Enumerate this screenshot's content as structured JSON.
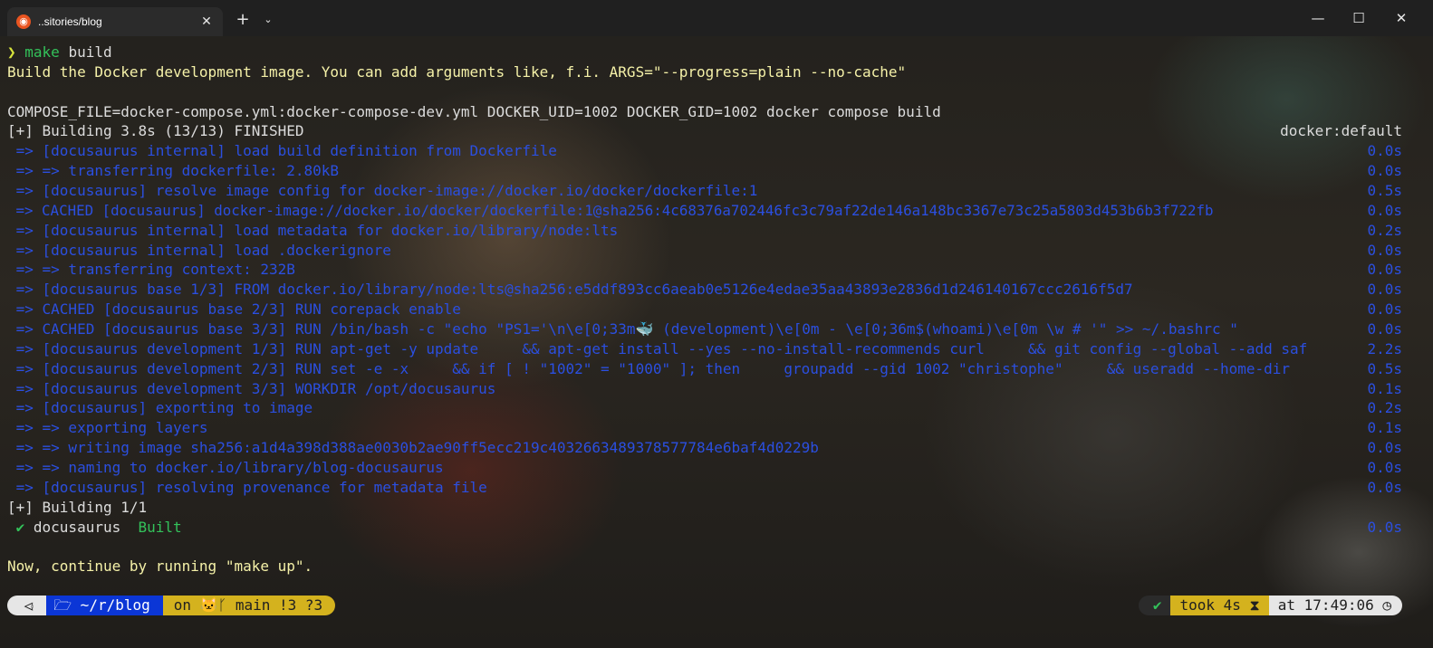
{
  "tab": {
    "title": "..sitories/blog",
    "icon": "ubuntu-icon",
    "close": "✕"
  },
  "titlebar": {
    "new_tab": "+",
    "menu": "⌄",
    "minimize": "—",
    "maximize": "☐",
    "close": "✕"
  },
  "terminal": {
    "prompt_symbol": "❯",
    "command_make": "make",
    "command_arg": " build",
    "build_info": "Build the Docker development image. You can add arguments like, f.i. ARGS=\"--progress=plain --no-cache\"",
    "compose_cmd": "COMPOSE_FILE=docker-compose.yml:docker-compose-dev.yml DOCKER_UID=1002 DOCKER_GID=1002 docker compose build",
    "building_header": "[+] Building 3.8s (13/13) FINISHED",
    "builder": "docker:default",
    "steps": [
      {
        "text": " => [docusaurus internal] load build definition from Dockerfile",
        "time": "0.0s"
      },
      {
        "text": " => => transferring dockerfile: 2.80kB",
        "time": "0.0s"
      },
      {
        "text": " => [docusaurus] resolve image config for docker-image://docker.io/docker/dockerfile:1",
        "time": "0.5s"
      },
      {
        "text": " => CACHED [docusaurus] docker-image://docker.io/docker/dockerfile:1@sha256:4c68376a702446fc3c79af22de146a148bc3367e73c25a5803d453b6b3f722fb",
        "time": "0.0s"
      },
      {
        "text": " => [docusaurus internal] load metadata for docker.io/library/node:lts",
        "time": "0.2s"
      },
      {
        "text": " => [docusaurus internal] load .dockerignore",
        "time": "0.0s"
      },
      {
        "text": " => => transferring context: 232B",
        "time": "0.0s"
      },
      {
        "text": " => [docusaurus base 1/3] FROM docker.io/library/node:lts@sha256:e5ddf893cc6aeab0e5126e4edae35aa43893e2836d1d246140167ccc2616f5d7",
        "time": "0.0s"
      },
      {
        "text": " => CACHED [docusaurus base 2/3] RUN corepack enable",
        "time": "0.0s"
      },
      {
        "text": " => CACHED [docusaurus base 3/3] RUN /bin/bash -c \"echo \"PS1='\\n\\e[0;33m🐳 (development)\\e[0m - \\e[0;36m$(whoami)\\e[0m \\w # '\" >> ~/.bashrc \"",
        "time": "0.0s"
      },
      {
        "text": " => [docusaurus development 1/3] RUN apt-get -y update     && apt-get install --yes --no-install-recommends curl     && git config --global --add saf",
        "time": "2.2s"
      },
      {
        "text": " => [docusaurus development 2/3] RUN set -e -x     && if [ ! \"1002\" = \"1000\" ]; then     groupadd --gid 1002 \"christophe\"     && useradd --home-dir",
        "time": "0.5s"
      },
      {
        "text": " => [docusaurus development 3/3] WORKDIR /opt/docusaurus",
        "time": "0.1s"
      },
      {
        "text": " => [docusaurus] exporting to image",
        "time": "0.2s"
      },
      {
        "text": " => => exporting layers",
        "time": "0.1s"
      },
      {
        "text": " => => writing image sha256:a1d4a398d388ae0030b2ae90ff5ecc219c4032663489378577784e6baf4d0229b",
        "time": "0.0s"
      },
      {
        "text": " => => naming to docker.io/library/blog-docusaurus",
        "time": "0.0s"
      },
      {
        "text": " => [docusaurus] resolving provenance for metadata file",
        "time": "0.0s"
      }
    ],
    "building_footer": "[+] Building 1/1",
    "built_check": " ✔",
    "built_name": " docusaurus",
    "built_status": "  Built",
    "built_time": "0.0s",
    "continue_msg": "Now, continue by running \"make up\"."
  },
  "prompt": {
    "os_icon": "⏿",
    "folder_icon": "🗁",
    "path": " ~/r/blog",
    "git_prefix": "on ",
    "github_icon": "🐱",
    "branch_icon": "ᚴ",
    "branch": " main !3 ?3",
    "status_check": "✔",
    "took": "took 4s ⧗",
    "at": "at 17:49:06 ◷"
  }
}
